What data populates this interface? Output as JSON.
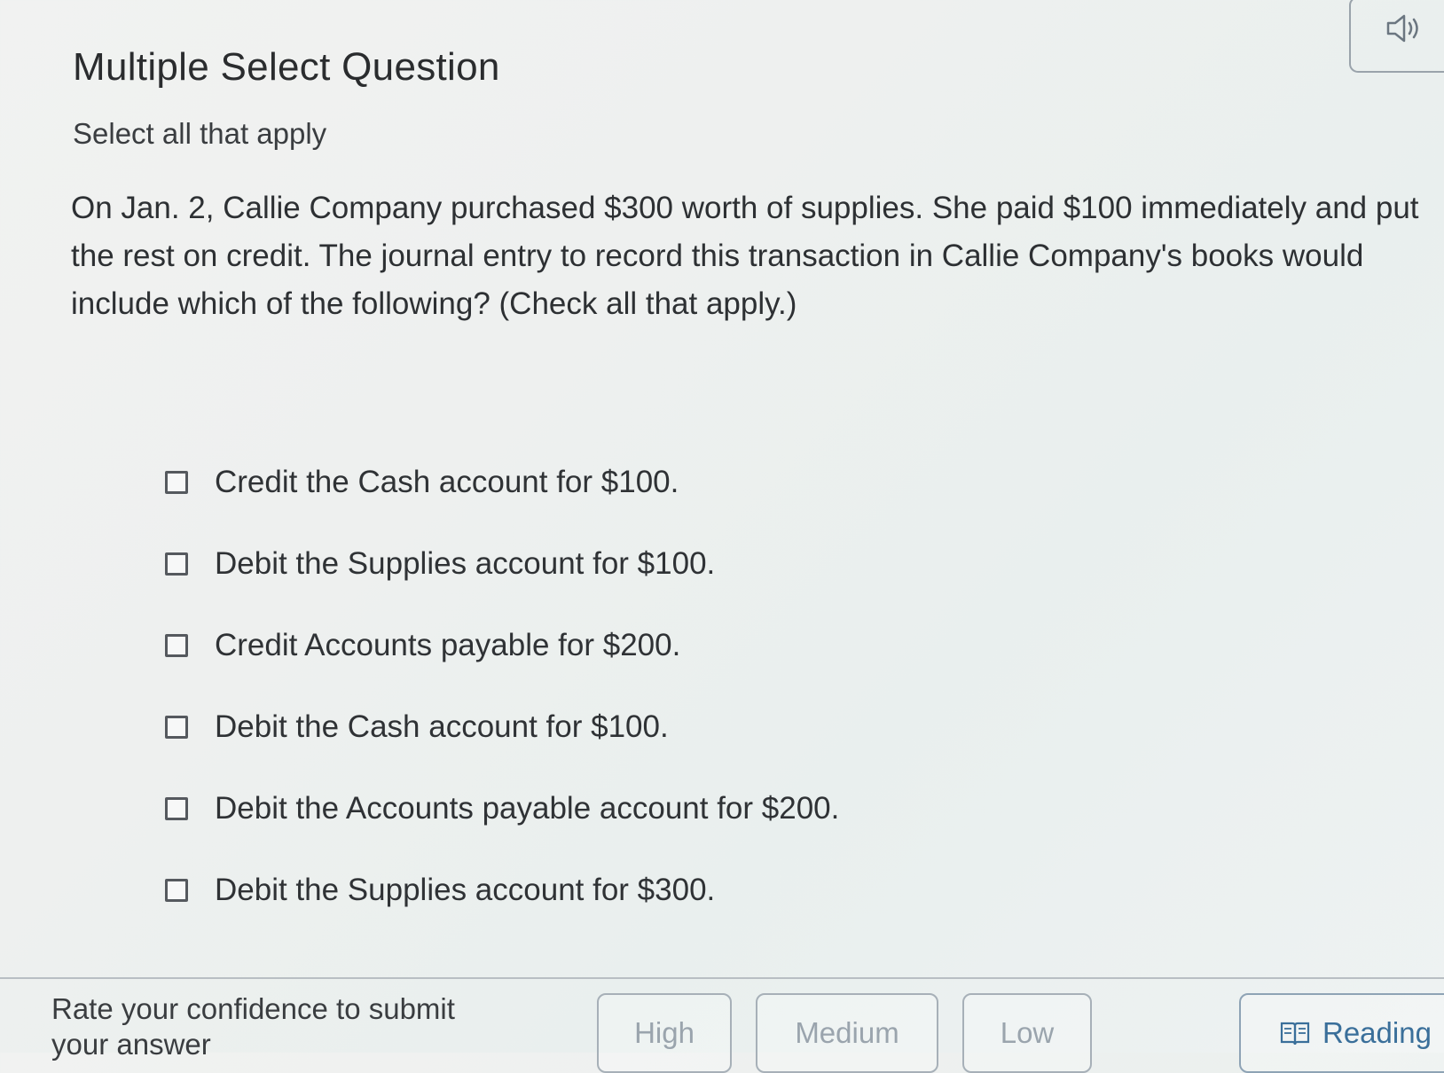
{
  "header": {
    "title": "Multiple Select Question",
    "audio_icon": "speaker-icon"
  },
  "instruction": "Select all that apply",
  "question": "On Jan. 2, Callie Company purchased $300 worth of supplies. She paid $100 immediately and put the rest on credit. The journal entry to record this transaction in Callie Company's books would include which of the following? (Check all that apply.)",
  "options": [
    {
      "label": "Credit the Cash account for $100.",
      "checked": false
    },
    {
      "label": "Debit the Supplies account for $100.",
      "checked": false
    },
    {
      "label": "Credit Accounts payable for $200.",
      "checked": false
    },
    {
      "label": "Debit the Cash account for $100.",
      "checked": false
    },
    {
      "label": "Debit the Accounts payable account for $200.",
      "checked": false
    },
    {
      "label": "Debit the Supplies account for $300.",
      "checked": false
    }
  ],
  "footer": {
    "confidence_label": "Rate your confidence to submit your answer",
    "buttons": {
      "high": "High",
      "medium": "Medium",
      "low": "Low",
      "reading": "Reading"
    },
    "reading_icon": "book-icon"
  },
  "colors": {
    "accent": "#3a6f9a",
    "text": "#2f3235",
    "muted": "#9aa4ad"
  }
}
